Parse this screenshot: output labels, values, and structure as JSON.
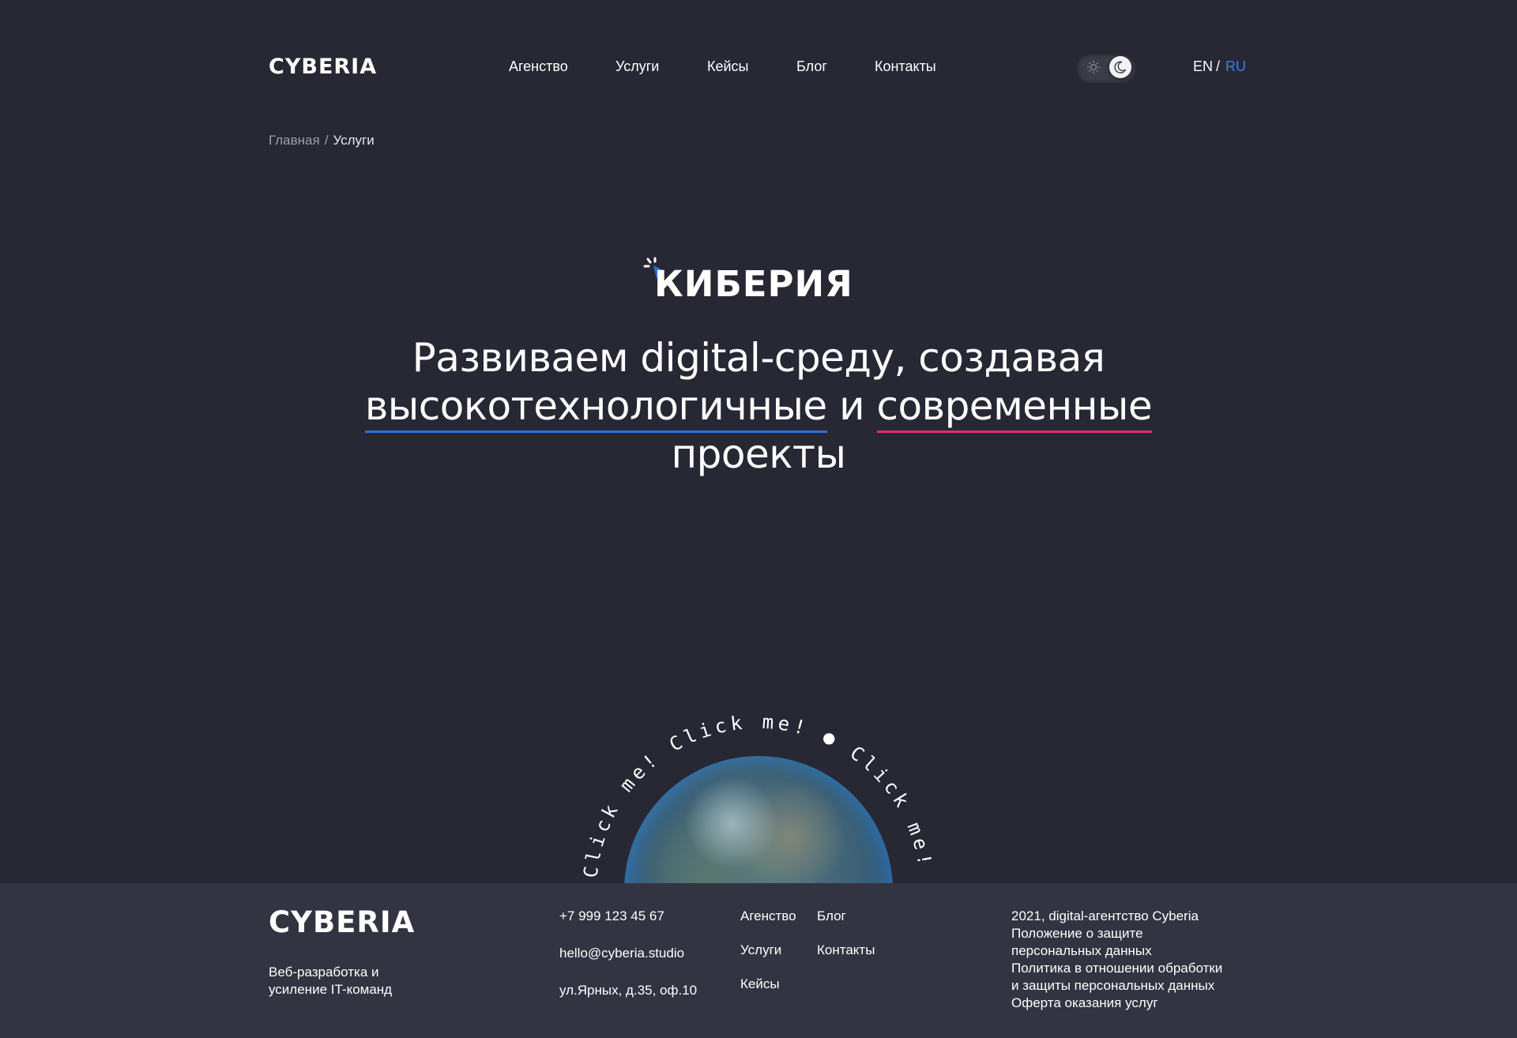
{
  "header": {
    "logo": "CYBERIA",
    "nav": [
      "Агенство",
      "Услуги",
      "Кейсы",
      "Блог",
      "Контакты"
    ],
    "theme_toggle": {
      "state": "dark",
      "icons": [
        "sun-icon",
        "moon-icon"
      ]
    },
    "lang": {
      "en": "EN",
      "separator": "/",
      "ru": "RU",
      "active": "RU"
    }
  },
  "breadcrumb": {
    "home": "Главная",
    "separator": "/",
    "current": "Услуги"
  },
  "hero": {
    "logo": "КИБЕРИЯ",
    "headline": {
      "part1": "Развиваем digital-среду, создавая",
      "highlight1": "высокотехнологичные",
      "connector": "и",
      "highlight2": "современные",
      "part2": "проекты"
    },
    "circular_text": "Click me! Click me! ● Click me! Click me! "
  },
  "footer": {
    "logo": "CYBERIA",
    "tagline_line1": "Веб-разработка и",
    "tagline_line2": "усиление IT-команд",
    "phone": "+7 999 123 45 67",
    "email": "hello@cyberia.studio",
    "address": "ул.Ярных, д.35, оф.10",
    "links_col1": [
      "Агенство",
      "Услуги",
      "Кейсы"
    ],
    "links_col2": [
      "Блог",
      "Контакты"
    ],
    "legal": {
      "copyright": "2021, digital-агентство Cyberia",
      "privacy_line1": "Положение о защите",
      "privacy_line2": "персональных данных",
      "policy_line1": "Политика в отношении обработки",
      "policy_line2": "и защиты персональных данных",
      "offer": "Оферта оказания услуг"
    }
  },
  "colors": {
    "background": "#272833",
    "footer_background": "#323441",
    "accent_blue": "#2f6fe4",
    "accent_pink": "#e0306c"
  }
}
